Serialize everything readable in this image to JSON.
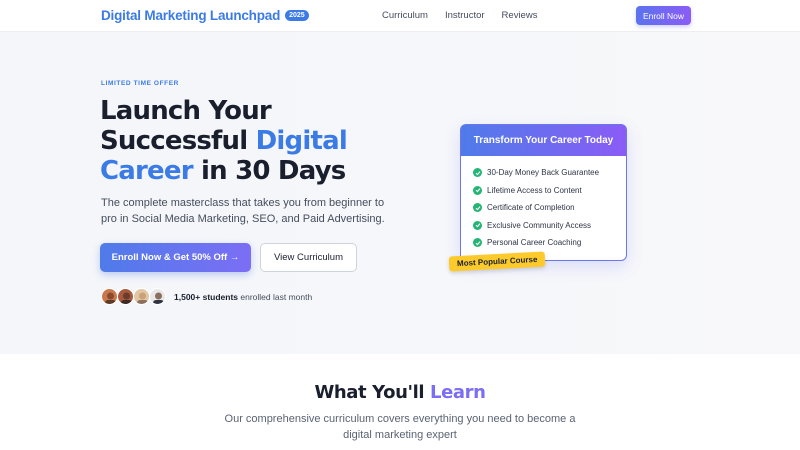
{
  "nav": {
    "brand": "Digital Marketing Launchpad",
    "badge": "2025",
    "links": [
      "Curriculum",
      "Instructor",
      "Reviews"
    ],
    "cta": "Enroll Now"
  },
  "hero": {
    "eyebrow": "LIMITED TIME OFFER",
    "title_line1": "Launch Your",
    "title_line2_plain": "Successful ",
    "title_line2_accent": "Digital",
    "title_line3_accent": "Career",
    "title_line3_plain": " in 30 Days",
    "subtitle": "The complete masterclass that takes you from beginner to pro in Social Media Marketing, SEO, and Paid Advertising.",
    "primary_button": "Enroll Now & Get 50% Off →",
    "secondary_button": "View Curriculum",
    "proof_count": "1,500+ students",
    "proof_text": " enrolled last month"
  },
  "card": {
    "title": "Transform Your Career Today",
    "items": [
      "30-Day Money Back Guarantee",
      "Lifetime Access to Content",
      "Certificate of Completion",
      "Exclusive Community Access",
      "Personal Career Coaching"
    ],
    "ribbon": "Most Popular Course"
  },
  "section": {
    "title_plain": "What You'll ",
    "title_accent": "Learn",
    "subtitle": "Our comprehensive curriculum covers everything you need to become a digital marketing expert"
  },
  "colors": {
    "accent": "#3b7be6",
    "gradient_start": "#4f7be9",
    "gradient_end": "#8b5cf6",
    "check": "#22b573",
    "ribbon": "#fccb2b"
  }
}
